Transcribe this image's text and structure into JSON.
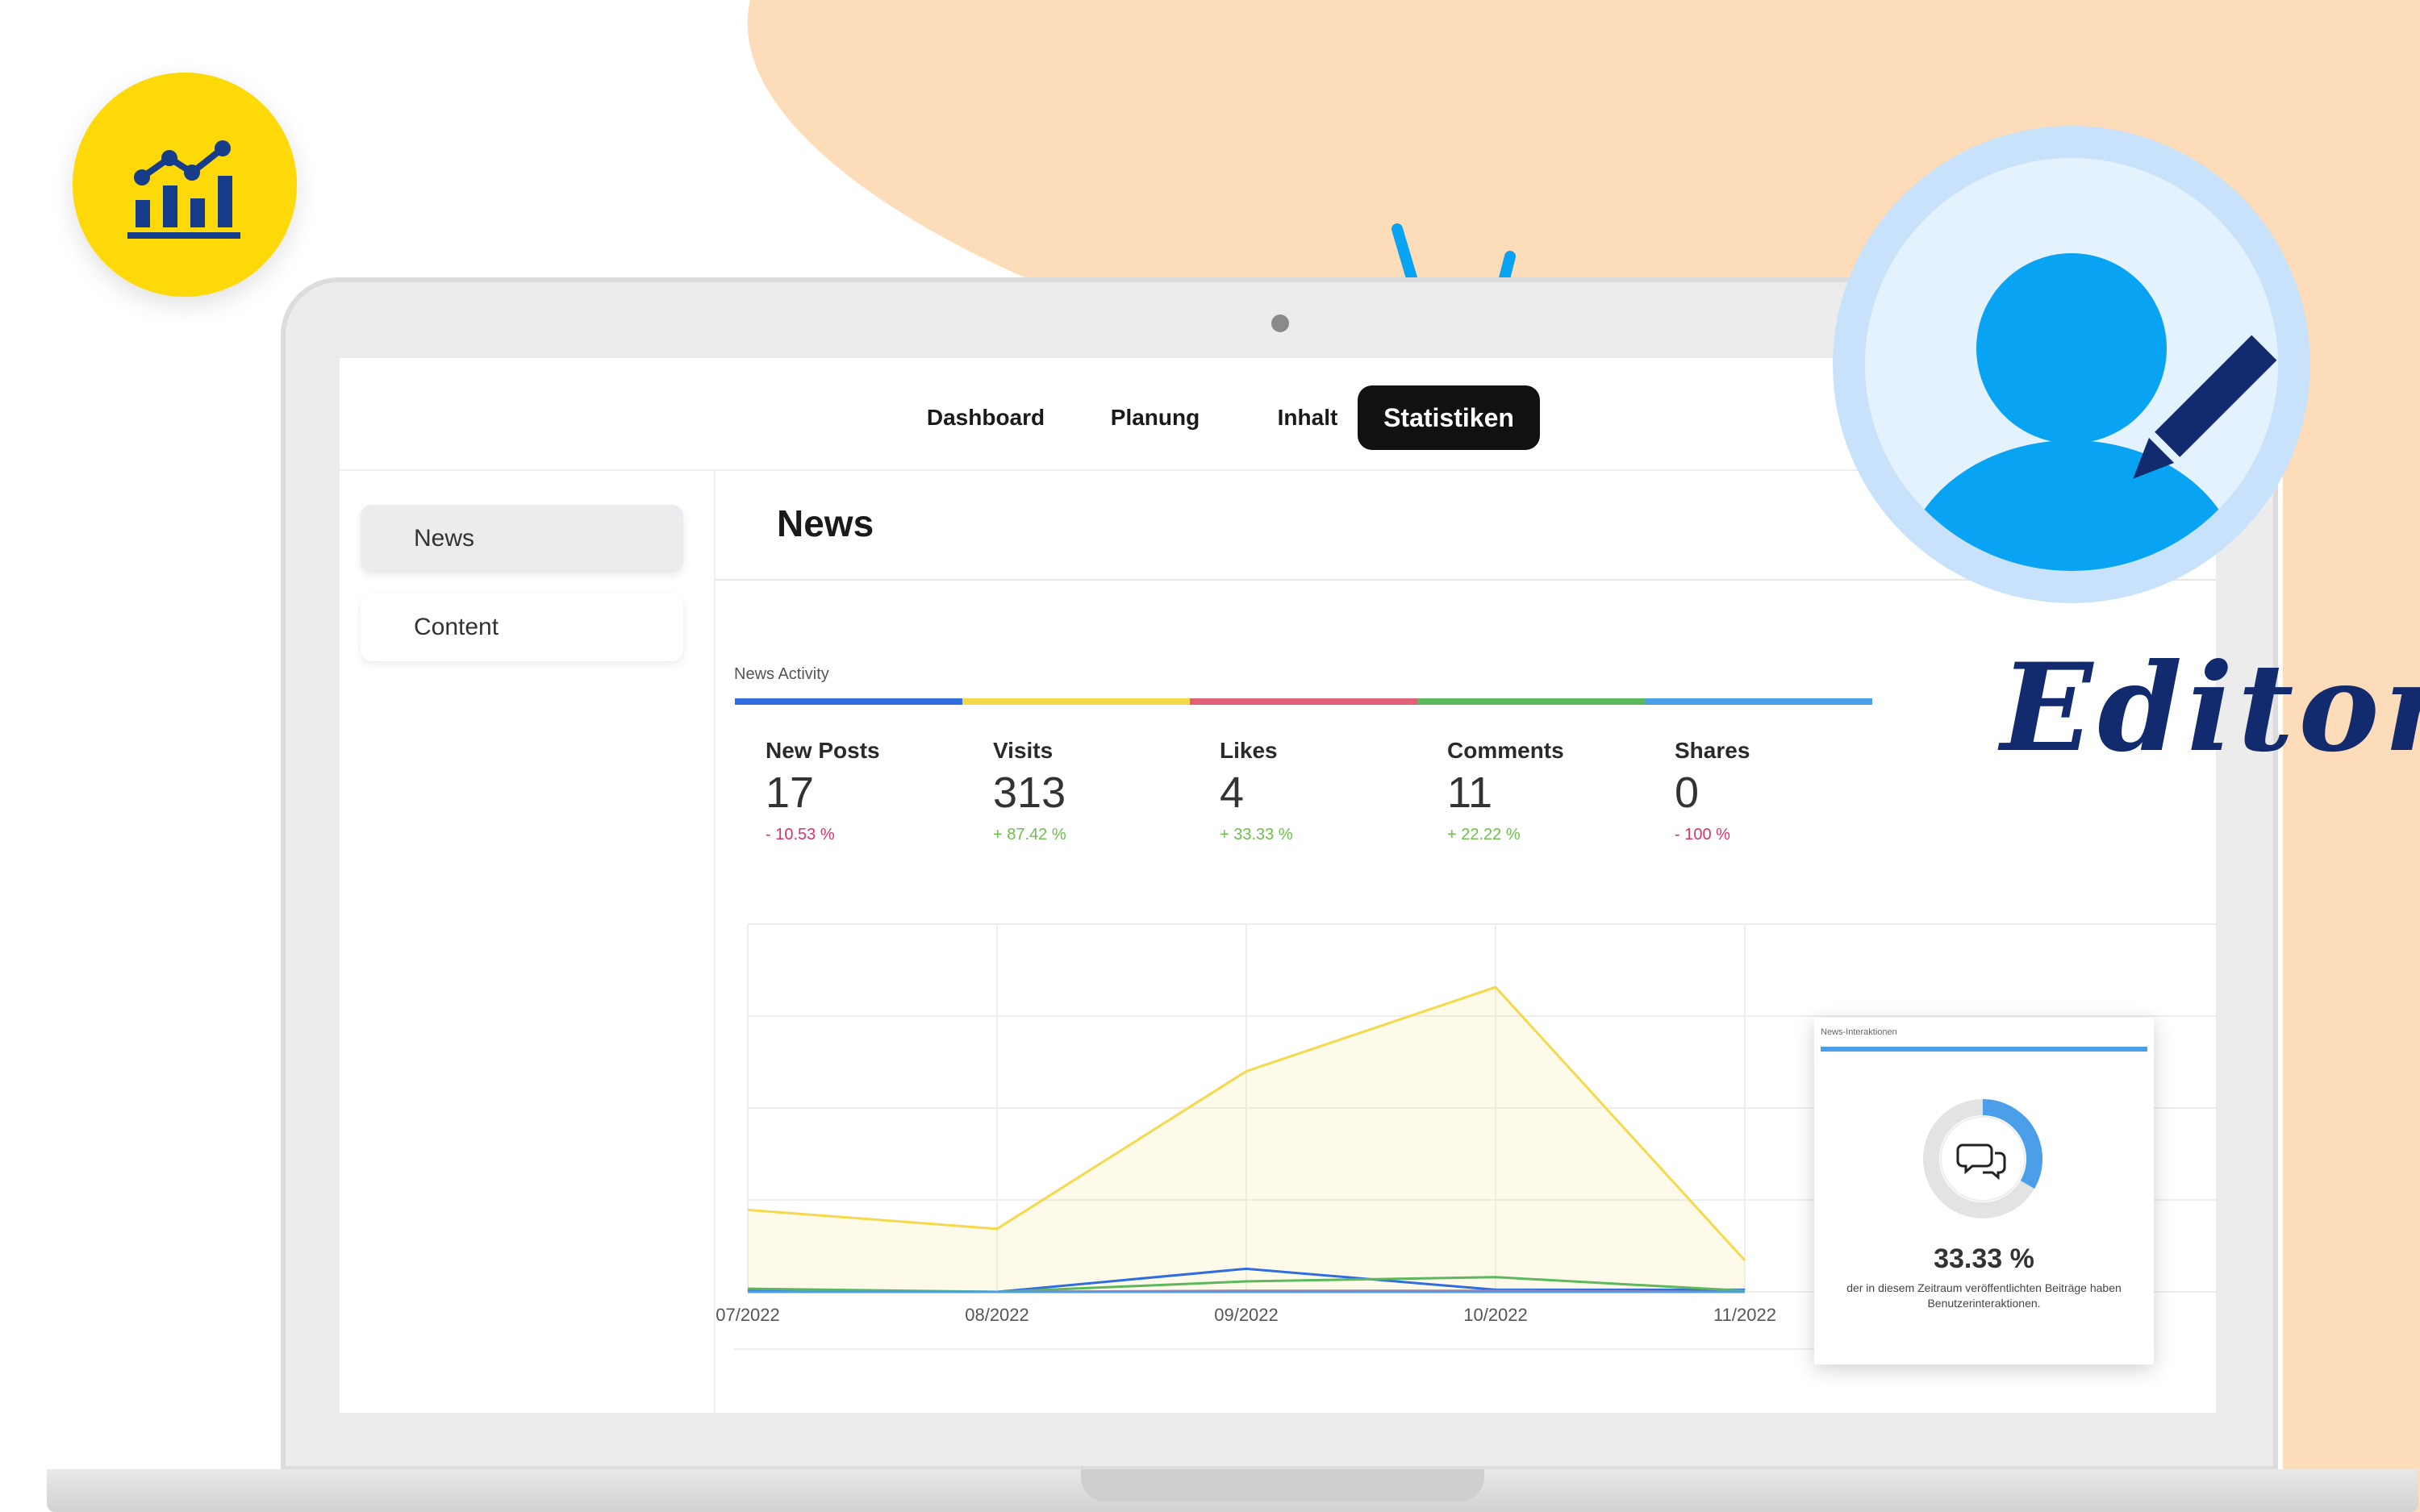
{
  "nav": {
    "items": [
      {
        "label": "Dashboard"
      },
      {
        "label": "Planung"
      },
      {
        "label": "Inhalt"
      },
      {
        "label": "Statistiken"
      }
    ],
    "active": "Statistiken"
  },
  "sidebar": {
    "items": [
      {
        "label": "News",
        "active": true
      },
      {
        "label": "Content",
        "active": false
      }
    ]
  },
  "page": {
    "title": "News"
  },
  "activity": {
    "label": "News Activity",
    "stats": [
      {
        "label": "New Posts",
        "value": "17",
        "delta": "- 10.53 %",
        "trend": "down",
        "color": "#2f6de1"
      },
      {
        "label": "Visits",
        "value": "313",
        "delta": "+ 87.42 %",
        "trend": "up",
        "color": "#f5d94a"
      },
      {
        "label": "Likes",
        "value": "4",
        "delta": "+ 33.33 %",
        "trend": "up",
        "color": "#e06075"
      },
      {
        "label": "Comments",
        "value": "11",
        "delta": "+ 22.22 %",
        "trend": "up",
        "color": "#5cb85c"
      },
      {
        "label": "Shares",
        "value": "0",
        "delta": "- 100 %",
        "trend": "down",
        "color": "#4a9fe8"
      }
    ]
  },
  "chart_data": {
    "type": "line",
    "categories": [
      "07/2022",
      "08/2022",
      "09/2022",
      "10/2022",
      "11/2022"
    ],
    "series": [
      {
        "name": "Visits",
        "color": "#f5d94a",
        "fill": true,
        "values": [
          78,
          60,
          210,
          290,
          30
        ]
      },
      {
        "name": "New Posts",
        "color": "#2f6de1",
        "values": [
          2,
          0,
          22,
          2,
          2
        ]
      },
      {
        "name": "Comments",
        "color": "#5cb85c",
        "values": [
          3,
          0,
          10,
          14,
          1
        ]
      },
      {
        "name": "Likes",
        "color": "#e06075",
        "values": [
          0,
          0,
          1,
          1,
          0
        ]
      },
      {
        "name": "Shares",
        "color": "#4a9fe8",
        "values": [
          0,
          0,
          0,
          0,
          0
        ]
      }
    ],
    "ylim": [
      0,
      350
    ],
    "grid": true
  },
  "card": {
    "title": "News-Interaktionen",
    "value": "33.33 %",
    "ratio": 0.3333,
    "description": "der in diesem Zeitraum veröffentlichten Beiträge haben Benutzerinteraktionen.",
    "icon": "chat-bubbles-icon"
  },
  "badges": {
    "chart_icon": "bar-line-chart-icon",
    "avatar_icon": "editor-avatar-icon",
    "editor_label": "Editor"
  },
  "colors": {
    "accent_yellow": "#fdd90a",
    "accent_blue": "#08a3f2",
    "peach": "#fcdcb9",
    "navy": "#122a6e"
  }
}
